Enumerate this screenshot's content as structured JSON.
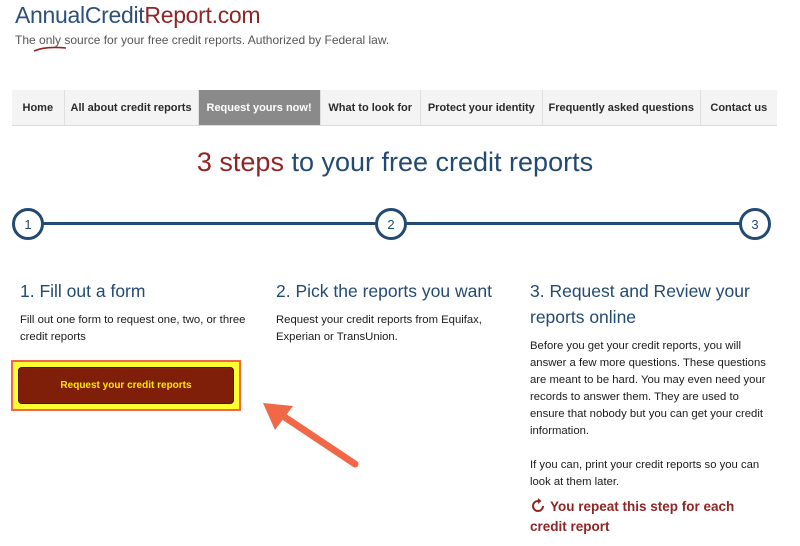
{
  "logo": {
    "annual": "Annual",
    "credit": "Credit",
    "report": "Report.com"
  },
  "tagline": {
    "pre": "The ",
    "only": "only",
    "post": " source for your free credit reports. Authorized by Federal law."
  },
  "nav": {
    "items": [
      "Home",
      "All about credit reports",
      "Request yours now!",
      "What to look for",
      "Protect your identity",
      "Frequently asked questions",
      "Contact us"
    ],
    "active": "Request yours now!"
  },
  "headline": {
    "accent": "3 steps",
    "rest": " to your free credit reports"
  },
  "steps": {
    "circles": [
      "1",
      "2",
      "3"
    ],
    "step1": {
      "title": "1. Fill out a form",
      "body": "Fill out one form to request one, two, or three credit reports",
      "button": "Request your credit reports"
    },
    "step2": {
      "title": "2. Pick the reports you want",
      "body": "Request your credit reports from Equifax, Experian or TransUnion."
    },
    "step3": {
      "title": "3. Request and Review your reports online",
      "body1": "Before you get your credit reports, you will answer a few more questions. These questions are meant to be hard. You may even need your records to answer them. They are used to ensure that nobody but you can get your credit information.",
      "body2": "If you can, print your credit reports so you can look at them later.",
      "repeat": "You repeat this step for each credit report"
    }
  },
  "colors": {
    "navy": "#234a72",
    "maroon": "#8f2525",
    "button_bg": "#7f1f0a",
    "button_text": "#ffe600",
    "highlight": "#ffff33",
    "arrow": "#f06848"
  },
  "icons": {
    "repeat": "refresh-icon",
    "pointer": "arrow-annotation"
  }
}
